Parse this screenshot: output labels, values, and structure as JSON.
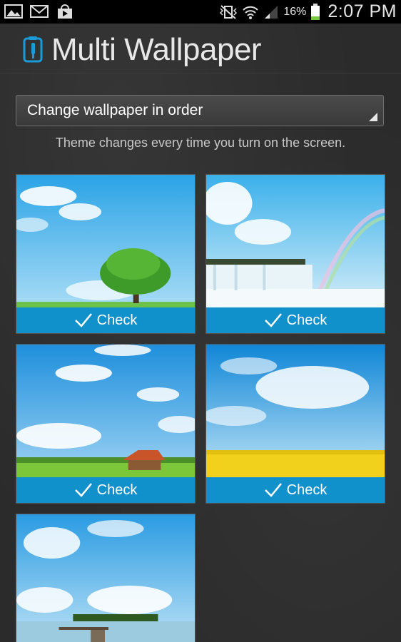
{
  "status_bar": {
    "battery_text": "16%",
    "time": "2:07 PM",
    "left_icons": [
      "gallery-icon",
      "email-icon",
      "play-store-icon"
    ],
    "right_icons": [
      "vibrate-mute-icon",
      "wifi-icon",
      "signal-icon",
      "battery-icon"
    ]
  },
  "header": {
    "title": "Multi Wallpaper",
    "logo": "phone-brush-icon",
    "accent": "#1a9ad6"
  },
  "mode_spinner": {
    "selected": "Change wallpaper in order"
  },
  "mode_description": "Theme changes every time you turn on the screen.",
  "wallpapers": [
    {
      "scene": "tree-in-meadow",
      "check_label": "Check"
    },
    {
      "scene": "waterfall-rainbow",
      "check_label": "Check"
    },
    {
      "scene": "house-in-field",
      "check_label": "Check"
    },
    {
      "scene": "yellow-flower-field",
      "check_label": "Check"
    },
    {
      "scene": "lake-pier",
      "check_label": null
    }
  ],
  "colors": {
    "check_bar": "#1191cc",
    "background": "#2b2b2b"
  }
}
